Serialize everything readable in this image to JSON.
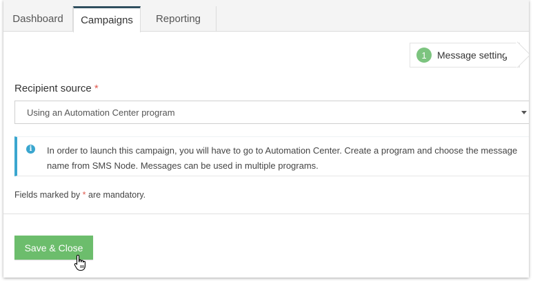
{
  "tabs": [
    {
      "label": "Dashboard",
      "active": false
    },
    {
      "label": "Campaigns",
      "active": true
    },
    {
      "label": "Reporting",
      "active": false
    }
  ],
  "steps": {
    "current_number": "1",
    "current_label": "Message settings"
  },
  "form": {
    "recipient_label": "Recipient source",
    "required_mark": "*",
    "recipient_value": "Using an Automation Center program"
  },
  "info": {
    "icon": "info-icon",
    "text": "In order to launch this campaign, you will have to go to Automation Center. Create a program and choose the message name from SMS Node. Messages can be used in multiple programs."
  },
  "note": {
    "prefix": "Fields marked by ",
    "mark": "*",
    "suffix": " are mandatory."
  },
  "actions": {
    "save_label": "Save & Close"
  },
  "colors": {
    "accent_green": "#6cbd6c",
    "info_blue": "#3aa6cf",
    "required_red": "#e05a4f",
    "active_tab_border": "#2f4f5f"
  }
}
